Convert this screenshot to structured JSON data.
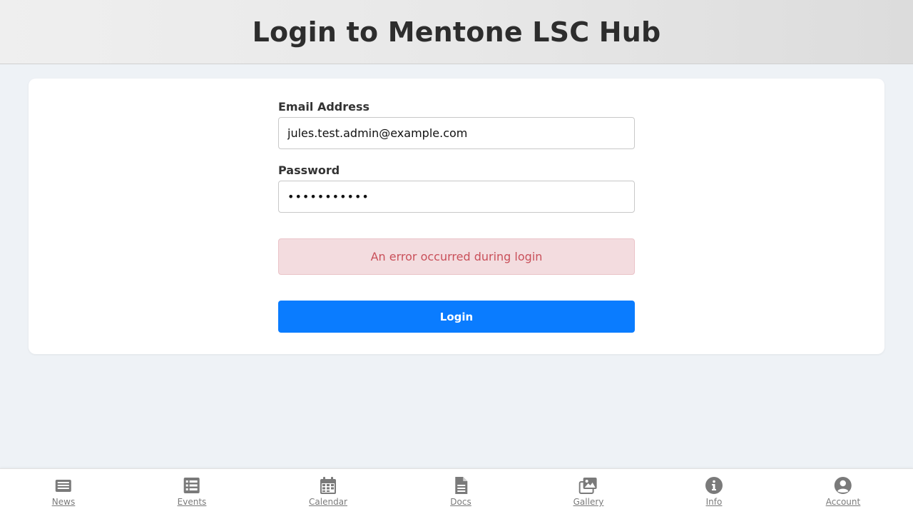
{
  "header": {
    "title": "Login to Mentone LSC Hub"
  },
  "form": {
    "email_label": "Email Address",
    "email_value": "jules.test.admin@example.com",
    "password_label": "Password",
    "password_value": "•••••••••••",
    "error_message": "An error occurred during login",
    "login_button": "Login"
  },
  "nav": {
    "items": [
      {
        "label": "News",
        "icon": "newspaper-icon"
      },
      {
        "label": "Events",
        "icon": "list-icon"
      },
      {
        "label": "Calendar",
        "icon": "calendar-icon"
      },
      {
        "label": "Docs",
        "icon": "document-icon"
      },
      {
        "label": "Gallery",
        "icon": "images-icon"
      },
      {
        "label": "Info",
        "icon": "info-icon"
      },
      {
        "label": "Account",
        "icon": "user-circle-icon"
      }
    ]
  },
  "colors": {
    "primary": "#0a7cff",
    "error_bg": "#f3dcdf",
    "error_text": "#c9505a",
    "nav_icon": "#7a7a7a"
  }
}
